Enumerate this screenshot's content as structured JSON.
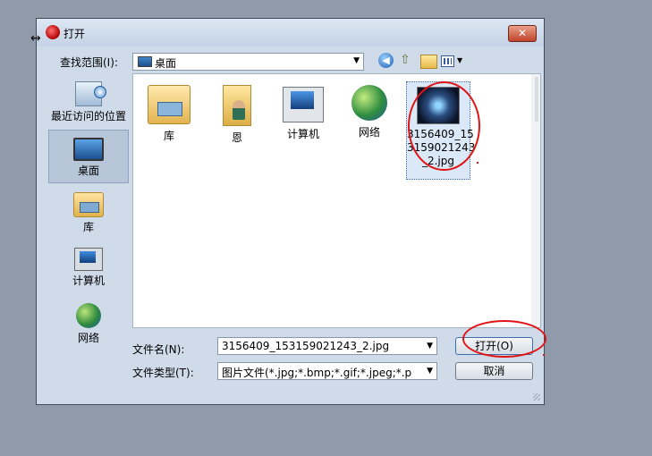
{
  "window": {
    "title": "打开",
    "close_symbol": "✕"
  },
  "lookin": {
    "label": "查找范围(I):",
    "value": "桌面",
    "arrow": "▼"
  },
  "toolbar": {
    "back_symbol": "◀",
    "up_symbol": "⇧",
    "view_arrow": "▼"
  },
  "places": [
    {
      "label": "最近访问的位置",
      "icon": "recent-places-icon"
    },
    {
      "label": "桌面",
      "icon": "desktop-icon"
    },
    {
      "label": "库",
      "icon": "libraries-icon"
    },
    {
      "label": "计算机",
      "icon": "computer-icon"
    },
    {
      "label": "网络",
      "icon": "network-icon"
    }
  ],
  "files": [
    {
      "label": "库",
      "icon": "libraries-folder-icon"
    },
    {
      "label": "恩",
      "icon": "user-folder-icon"
    },
    {
      "label": "计算机",
      "icon": "computer-icon"
    },
    {
      "label": "网络",
      "icon": "network-icon"
    },
    {
      "label": "3156409_153159021243_2.jpg",
      "label_lines": [
        "3156409_15",
        "3159021243",
        "_2.jpg"
      ],
      "icon": "image-thumbnail",
      "selected": true
    }
  ],
  "filename": {
    "label": "文件名(N):",
    "value": "3156409_153159021243_2.jpg",
    "arrow": "▼"
  },
  "filetype": {
    "label": "文件类型(T):",
    "value": "图片文件(*.jpg;*.bmp;*.gif;*.jpeg;*.p",
    "arrow": "▼"
  },
  "buttons": {
    "open": "打开(O)",
    "cancel": "取消"
  },
  "colors": {
    "annotation": "#e01515",
    "dialog_bg": "#cfdbe9",
    "desktop_bg": "#8f9aaa"
  }
}
